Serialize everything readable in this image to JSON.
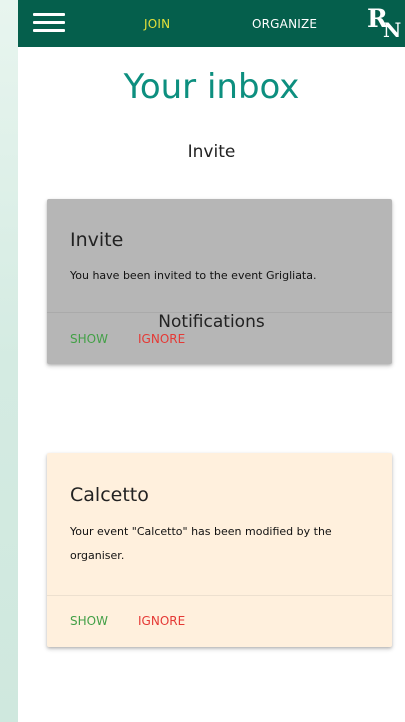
{
  "navbar": {
    "menu_icon": "hamburger-menu-icon",
    "join_label": "JOIN",
    "organize_label": "ORGANIZE",
    "logo_letters": {
      "first": "R",
      "second": "N"
    },
    "colors": {
      "background": "#055f4c",
      "active_link": "#e3e03a",
      "link": "#ffffff"
    }
  },
  "page": {
    "title": "Your inbox",
    "title_color": "#0d8f7f"
  },
  "sections": {
    "invite_heading": "Invite",
    "notifications_heading": "Notifications"
  },
  "invite_card": {
    "title": "Invite",
    "message": "You have been invited to the event Grigliata.",
    "show_label": "SHOW",
    "ignore_label": "IGNORE",
    "background": "#b6b6b6"
  },
  "notification_card": {
    "title": "Calcetto",
    "message": "Your event \"Calcetto\" has been modified by the organiser.",
    "show_label": "SHOW",
    "ignore_label": "IGNORE",
    "background": "#fff0dd"
  },
  "action_colors": {
    "show": "#43a047",
    "ignore": "#e53935"
  }
}
